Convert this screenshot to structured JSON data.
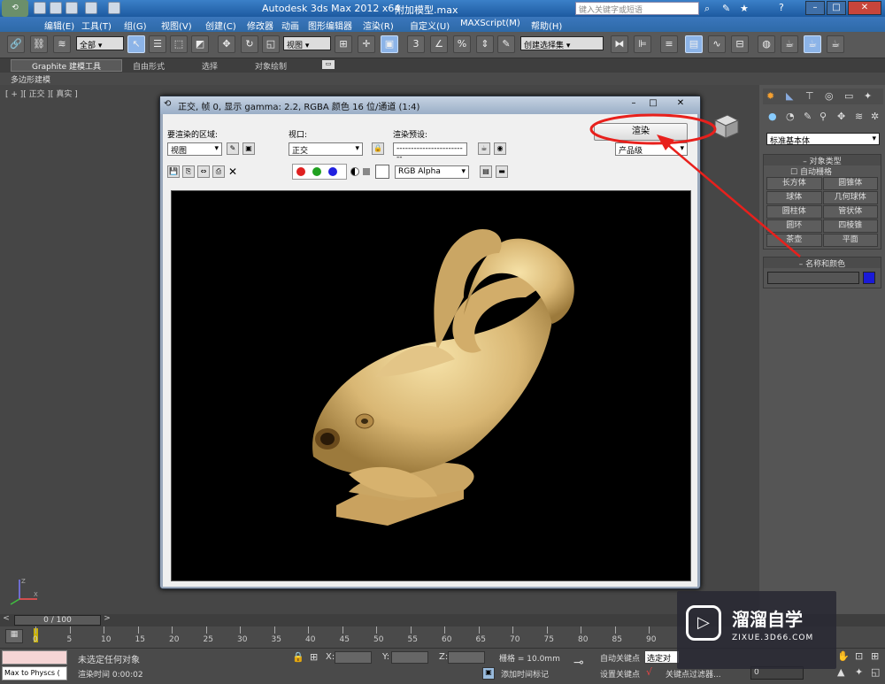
{
  "app": {
    "title": "Autodesk 3ds Max  2012 x64",
    "file": "附加模型.max",
    "search_placeholder": "键入关键字或短语"
  },
  "menu": [
    "编辑(E)",
    "工具(T)",
    "组(G)",
    "视图(V)",
    "创建(C)",
    "修改器",
    "动画",
    "图形编辑器",
    "渲染(R)",
    "自定义(U)",
    "MAXScript(M)",
    "帮助(H)"
  ],
  "toolbar": {
    "selection_filter": "全部",
    "reference_coord": "视图",
    "named_selection": "创建选择集"
  },
  "ribbon": {
    "tabs": [
      "Graphite 建模工具",
      "自由形式",
      "选择",
      "对象绘制"
    ],
    "subtab": "多边形建模"
  },
  "viewport": {
    "label": "[ + ][ 正交 ][ 真实 ]"
  },
  "render_window": {
    "title": "正交, 帧 0, 显示 gamma: 2.2, RGBA 颜色 16 位/通道 (1:4)",
    "area_label": "要渲染的区域:",
    "area_value": "视图",
    "viewport_label": "视口:",
    "viewport_value": "正交",
    "preset_label": "渲染预设:",
    "preset_value": "-------------------------",
    "render_button": "渲染",
    "quality_value": "产品级",
    "channel_value": "RGB Alpha"
  },
  "command_panel": {
    "category": "标准基本体",
    "object_type_header": "对象类型",
    "autogrid_label": "自动栅格",
    "objects": [
      "长方体",
      "圆锥体",
      "球体",
      "几何球体",
      "圆柱体",
      "管状体",
      "圆环",
      "四棱锥",
      "茶壶",
      "平面"
    ],
    "name_color_header": "名称和颜色"
  },
  "timeline": {
    "frame": "0 / 100",
    "ticks": [
      "0",
      "5",
      "10",
      "15",
      "20",
      "25",
      "30",
      "35",
      "40",
      "45",
      "50",
      "55",
      "60",
      "65",
      "70",
      "75",
      "80",
      "85",
      "90"
    ]
  },
  "status": {
    "script_listener": "Max to Physcs (",
    "selection": "未选定任何对象",
    "render_time": "渲染时间 0:00:02",
    "x_label": "X:",
    "y_label": "Y:",
    "z_label": "Z:",
    "grid": "栅格 = 10.0mm",
    "add_time_tag": "添加时间标记",
    "auto_key": "自动关键点",
    "set_key": "设置关键点",
    "selected": "选定对象",
    "key_filters": "关键点过滤器...",
    "frame_field": "0"
  },
  "watermark": {
    "title": "溜溜自学",
    "url": "ZIXUE.3D66.COM"
  },
  "colors": {
    "title_blue": "#2e6aa8",
    "annotation_red": "#e8201c",
    "object_color": "#1a1ad8",
    "gold": "#d9b774"
  }
}
